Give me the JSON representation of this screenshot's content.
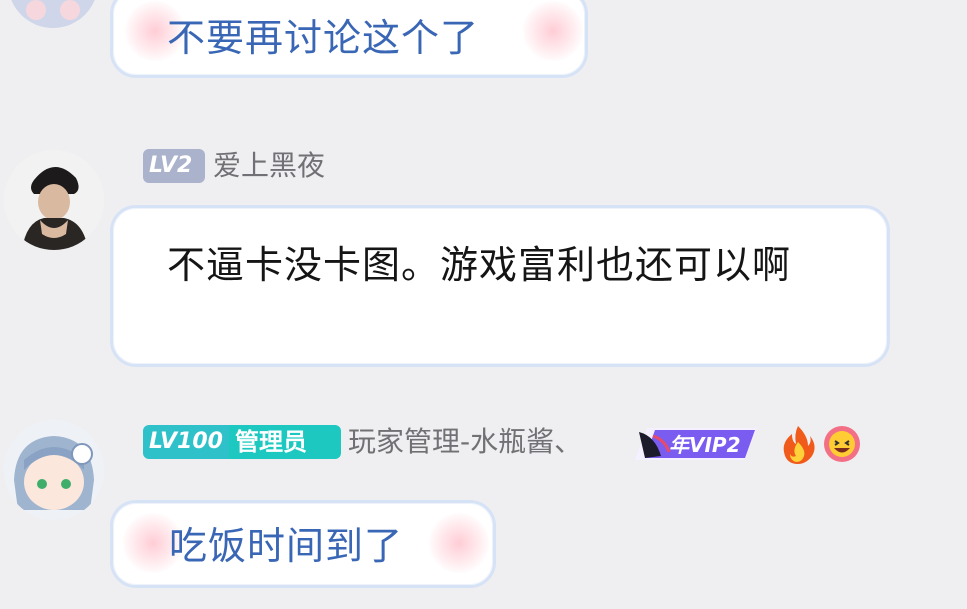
{
  "messages": [
    {
      "text": "不要再讨论这个了"
    },
    {
      "level": "LV2",
      "nickname": "爱上黑夜",
      "text": "不逼卡没卡图。游戏富利也还可以啊"
    },
    {
      "level": "LV100",
      "role": "管理员",
      "nickname": "玩家管理-水瓶酱、",
      "vip_text": "年VIP2",
      "text": "吃饭时间到了"
    }
  ],
  "colors": {
    "background": "#efeff1",
    "bubble_text_blue": "#3a67b5",
    "lv2_badge": "#aab2cc",
    "lv100_badge": "#2fc1c9",
    "role_badge": "#1cc8c0"
  },
  "icons": [
    "fire-icon",
    "laughing-face-icon",
    "vip-badge-icon"
  ]
}
